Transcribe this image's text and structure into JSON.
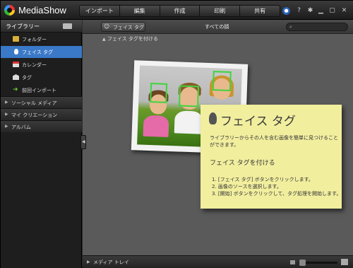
{
  "app": {
    "title": "MediaShow"
  },
  "nav": [
    "インポート",
    "編集",
    "作成",
    "印刷",
    "共有"
  ],
  "toolbar_icons": {
    "help": "?",
    "settings": "gear-icon",
    "minimize": "▁",
    "maximize": "▢",
    "close": "✕"
  },
  "library": {
    "title": "ライブラリー",
    "items": [
      {
        "label": "フォルダー",
        "icon": "folder-icon"
      },
      {
        "label": "フェイス タグ",
        "icon": "face-icon",
        "active": true
      },
      {
        "label": "カレンダー",
        "icon": "calendar-icon"
      },
      {
        "label": "タグ",
        "icon": "tag-icon"
      },
      {
        "label": "前回インポート",
        "icon": "import-icon"
      }
    ],
    "sections": [
      "ソーシャル メディア",
      "マイ クリエーション",
      "アルバム"
    ]
  },
  "main": {
    "facetag_button": "フェイス タグ",
    "heading": "すべての顔",
    "add_facetag": "フェイス タグを付ける",
    "search_placeholder": ""
  },
  "note": {
    "title": "フェイス タグ",
    "description": "ライブラリーからその人を含む画像を簡単に見つけることができます。",
    "subtitle": "フェイス タグを付ける",
    "steps": [
      "1. [フェイス タグ] ボタンをクリックします。",
      "2. 画像のソースを選択します。",
      "3. [開始] ボタンをクリックして、タグ処理を開始します。"
    ]
  },
  "bottom": {
    "media_tray": "メディア トレイ"
  },
  "colors": {
    "accent": "#3a78c8",
    "note": "#f1ee9e",
    "face_box": "#3fd43f"
  }
}
